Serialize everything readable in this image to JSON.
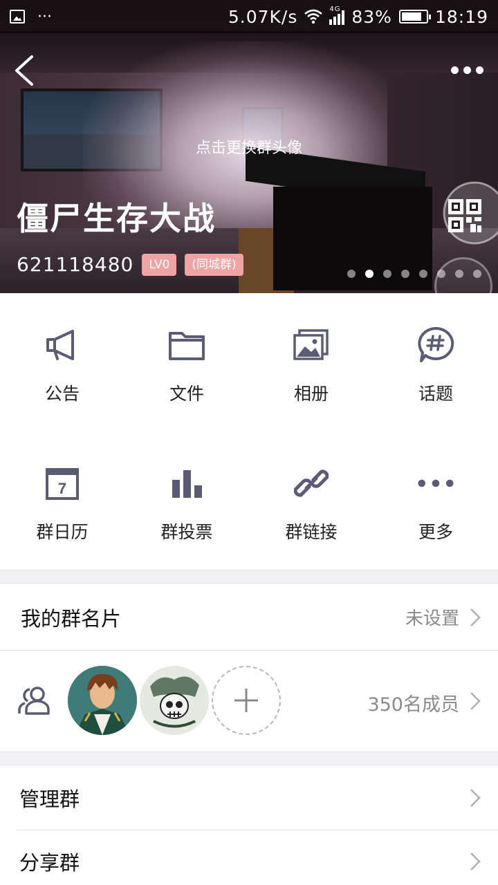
{
  "status_bar": {
    "network_speed": "5.07K/s",
    "network_type": "4G",
    "battery": "83%",
    "battery_level": 0.83,
    "time": "18:19"
  },
  "header": {
    "avatar_hint": "点击更换群头像",
    "group_name": "僵尸生存大战",
    "group_id": "621118480",
    "level_badge": "LV0",
    "type_badge": "(同城群)",
    "carousel_total": 8,
    "carousel_active": 2
  },
  "features": [
    {
      "label": "公告",
      "icon": "megaphone-icon"
    },
    {
      "label": "文件",
      "icon": "folder-icon"
    },
    {
      "label": "相册",
      "icon": "photo-album-icon"
    },
    {
      "label": "话题",
      "icon": "hashtag-chat-icon"
    },
    {
      "label": "群日历",
      "icon": "calendar-icon"
    },
    {
      "label": "群投票",
      "icon": "bar-chart-icon"
    },
    {
      "label": "群链接",
      "icon": "link-icon"
    },
    {
      "label": "更多",
      "icon": "more-dots-icon"
    }
  ],
  "card": {
    "title": "我的群名片",
    "value": "未设置"
  },
  "members": {
    "count": "350名成员"
  },
  "actions": {
    "manage": "管理群",
    "share": "分享群"
  },
  "colors": {
    "icon": "#5a5c75",
    "badge": "#f0a3a3",
    "secondary_text": "#8a8a8a"
  }
}
